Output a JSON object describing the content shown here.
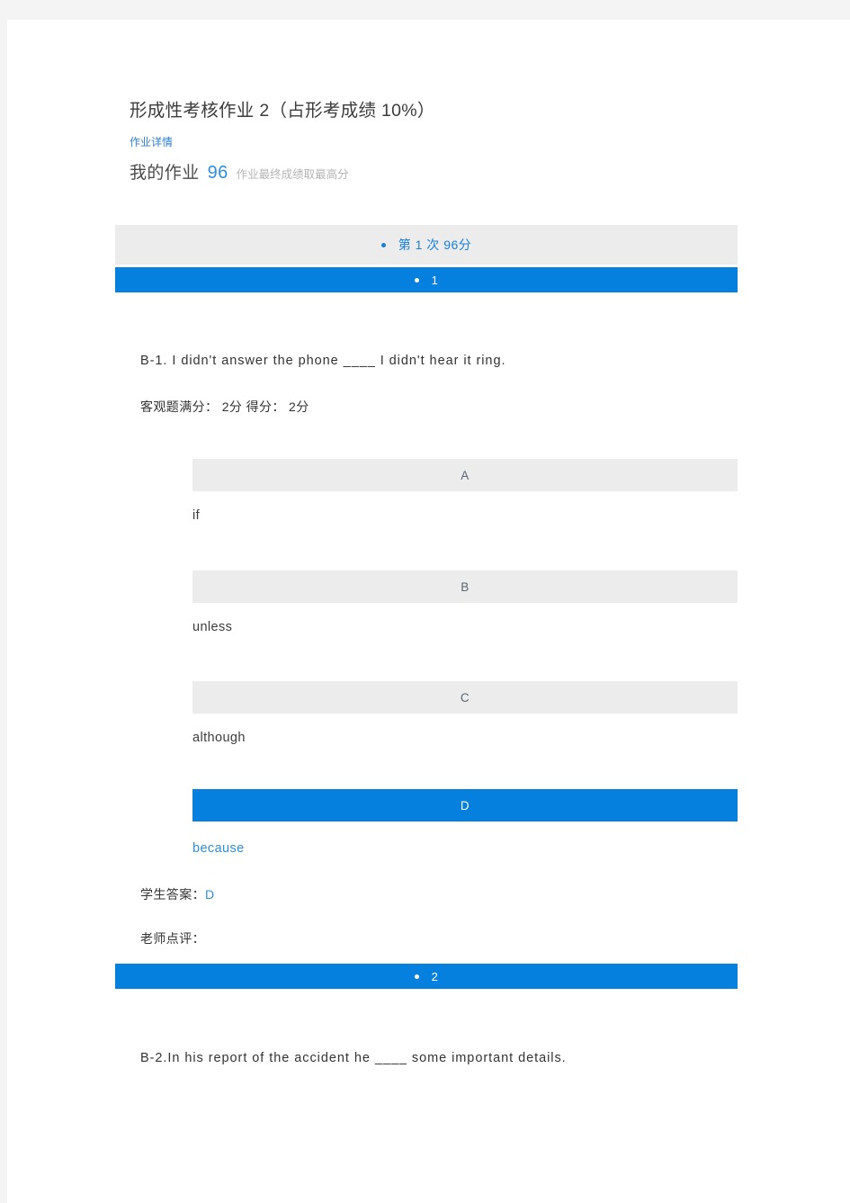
{
  "header": {
    "assignment_title": "形成性考核作业 2（占形考成绩 10%）",
    "detail_link": "作业详情",
    "my_work_label": "我的作业",
    "my_work_score": "96",
    "my_work_note": "作业最终成绩取最高分"
  },
  "attempts": [
    {
      "label": "第 1 次  96分"
    }
  ],
  "questions": [
    {
      "number": "1",
      "stem": "B-1. I didn't answer the phone ____ I didn't hear it ring.",
      "score_line": "客观题满分： 2分 得分： 2分",
      "options": [
        {
          "letter": "A",
          "text": "if",
          "selected": false
        },
        {
          "letter": "B",
          "text": "unless",
          "selected": false
        },
        {
          "letter": "C",
          "text": "although",
          "selected": false
        },
        {
          "letter": "D",
          "text": "because",
          "selected": true
        }
      ],
      "student_answer_label": "学生答案：",
      "student_answer_value": "D",
      "teacher_comment_label": "老师点评：",
      "teacher_comment_value": ""
    },
    {
      "number": "2",
      "stem": "B-2.In his report of the accident he ____ some important details."
    }
  ],
  "colors": {
    "accent_blue": "#0680de",
    "link_blue": "#2d8fe0",
    "bar_gray": "#ececec",
    "page_gray": "#f4f4f4"
  }
}
